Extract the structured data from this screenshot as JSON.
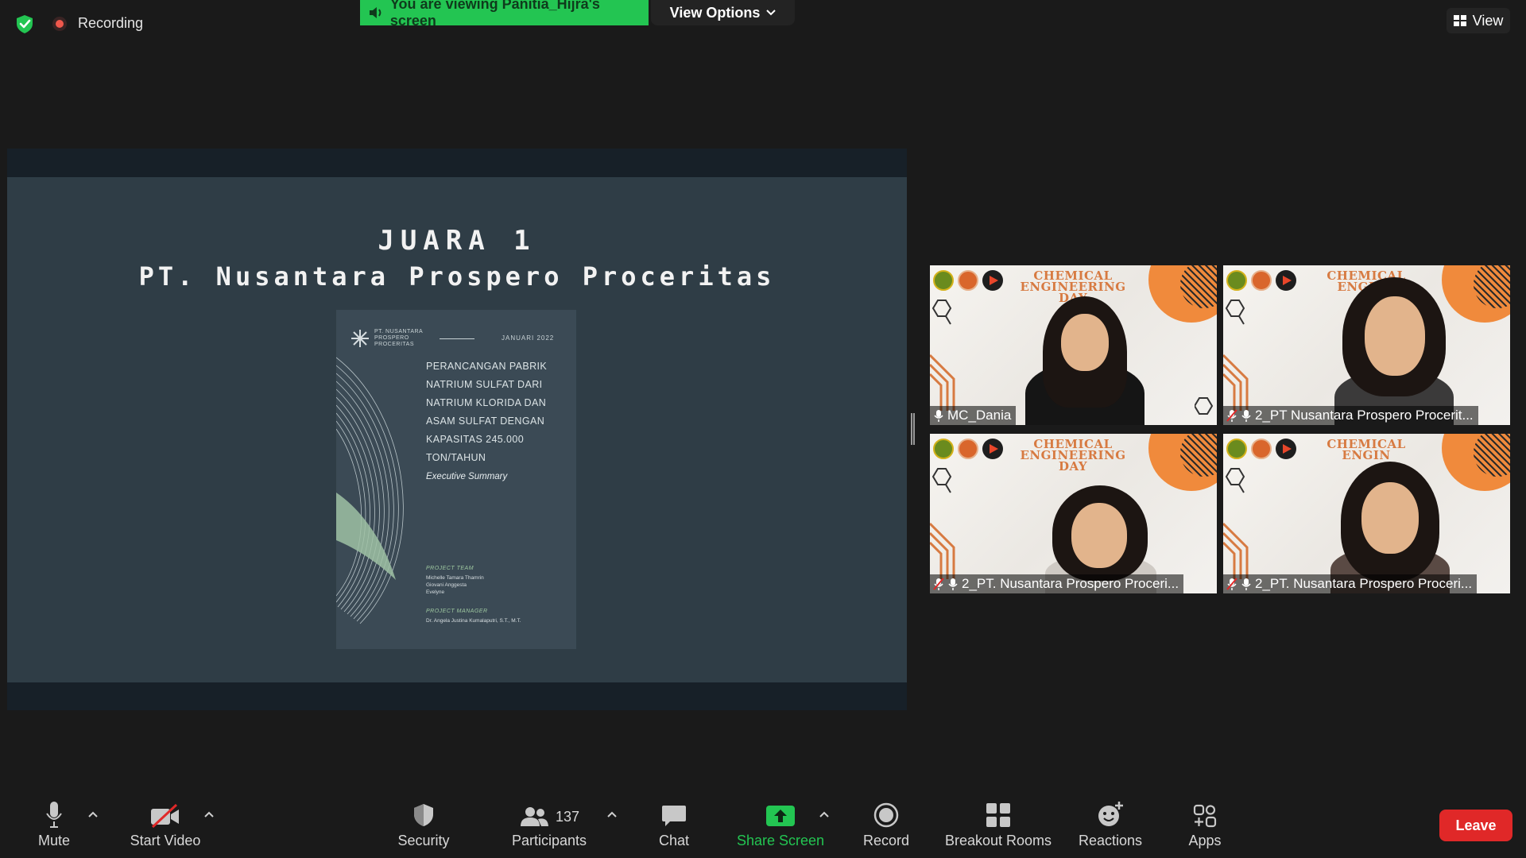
{
  "topbar": {
    "recording_label": "Recording",
    "viewing_banner": "You are viewing Panitia_Hijra's screen",
    "view_options_label": "View Options",
    "view_label": "View"
  },
  "shared_slide": {
    "title_line1": "JUARA 1",
    "title_line2": "PT. Nusantara Prospero Proceritas",
    "document": {
      "logo_text": [
        "PT. NUSANTARA",
        "PROSPERO",
        "PROCERITAS"
      ],
      "date": "JANUARI 2022",
      "heading_lines": [
        "PERANCANGAN PABRIK",
        "NATRIUM SULFAT DARI",
        "NATRIUM KLORIDA DAN",
        "ASAM SULFAT DENGAN",
        "KAPASITAS 245.000",
        "TON/TAHUN"
      ],
      "subtitle": "Executive Summary",
      "project_team_label": "PROJECT TEAM",
      "project_team": [
        "Michelle Tamara Thamrin",
        "Giovani Anggesta",
        "Evelyne"
      ],
      "project_manager_label": "PROJECT MANAGER",
      "project_manager": "Dr. Angela Justina Kumalaputri, S.T., M.T."
    }
  },
  "tiles": [
    {
      "name": "MC_Dania",
      "banner": [
        "CHEMICAL",
        "ENGINEERING",
        "DAY"
      ]
    },
    {
      "name": "2_PT Nusantara Prospero Procerit...",
      "banner": [
        "CHEMICAL",
        "ENGINE"
      ]
    },
    {
      "name": "2_PT. Nusantara Prospero Proceri...",
      "banner": [
        "CHEMICAL",
        "ENGINEERING",
        "DAY"
      ]
    },
    {
      "name": "2_PT. Nusantara Prospero Proceri...",
      "banner": [
        "CHEMICAL",
        "ENGIN"
      ]
    }
  ],
  "toolbar": {
    "mute": "Mute",
    "start_video": "Start Video",
    "security": "Security",
    "participants": "Participants",
    "participants_count": "137",
    "chat": "Chat",
    "share_screen": "Share Screen",
    "record": "Record",
    "breakout_rooms": "Breakout Rooms",
    "reactions": "Reactions",
    "apps": "Apps",
    "leave": "Leave"
  },
  "colors": {
    "accent_green": "#23c552",
    "leave_red": "#e02828",
    "recording_red": "#f0584c",
    "slide_bg": "#2f3d46"
  }
}
